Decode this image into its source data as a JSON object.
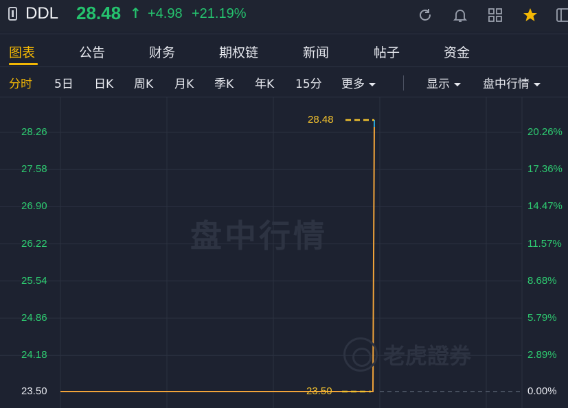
{
  "header": {
    "symbol": "DDL",
    "price": "28.48",
    "change": "+4.98",
    "change_pct": "+21.19%",
    "icons": [
      "back-icon",
      "refresh-icon",
      "bell-icon",
      "grid-icon",
      "star-icon",
      "panel-icon"
    ],
    "colors": {
      "up": "#25c26e",
      "accent": "#f2b705",
      "background": "#1d2230"
    }
  },
  "tabs": [
    {
      "label": "图表",
      "active": true
    },
    {
      "label": "公告"
    },
    {
      "label": "财务"
    },
    {
      "label": "期权链"
    },
    {
      "label": "新闻"
    },
    {
      "label": "帖子"
    },
    {
      "label": "资金"
    }
  ],
  "subtabs": [
    {
      "label": "分时",
      "active": true
    },
    {
      "label": "5日"
    },
    {
      "label": "日K"
    },
    {
      "label": "周K"
    },
    {
      "label": "月K"
    },
    {
      "label": "季K"
    },
    {
      "label": "年K"
    },
    {
      "label": "15分"
    },
    {
      "label": "更多"
    }
  ],
  "controls": {
    "display_label": "显示",
    "session_label": "盘中行情"
  },
  "watermark": {
    "text": "盘中行情",
    "brand": "老虎證券"
  },
  "chart_data": {
    "type": "line",
    "y_left": [
      "28.26",
      "27.58",
      "26.90",
      "26.22",
      "25.54",
      "24.86",
      "24.18",
      "23.50"
    ],
    "y_right": [
      "20.26%",
      "17.36%",
      "14.47%",
      "11.57%",
      "8.68%",
      "5.79%",
      "2.89%",
      "0.00%"
    ],
    "ylim": [
      23.5,
      28.48
    ],
    "base_price": 23.5,
    "high_label": "28.48",
    "low_label": "23.50",
    "series": [
      {
        "values": [
          23.5,
          23.5,
          23.5,
          28.48
        ]
      }
    ]
  }
}
